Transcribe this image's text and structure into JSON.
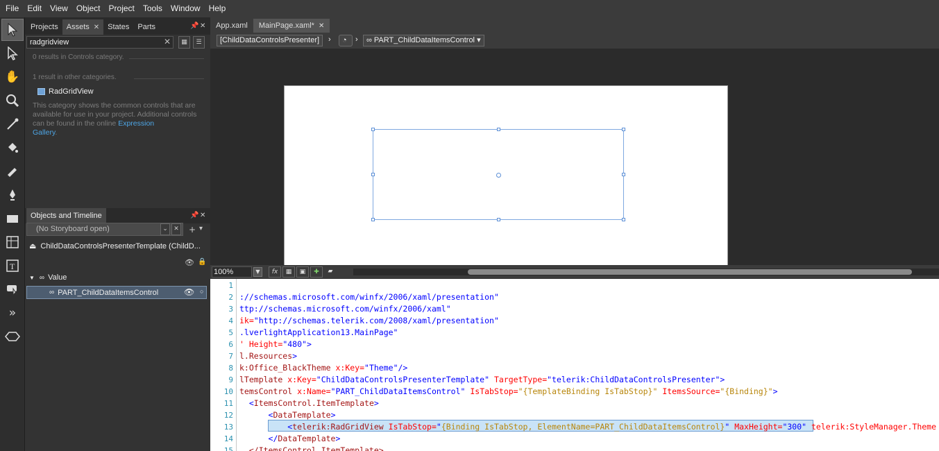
{
  "menu": [
    "File",
    "Edit",
    "View",
    "Object",
    "Project",
    "Tools",
    "Window",
    "Help"
  ],
  "left_panel": {
    "tabs": [
      {
        "label": "Projects",
        "active": false
      },
      {
        "label": "Assets",
        "active": true
      },
      {
        "label": "States",
        "active": false
      },
      {
        "label": "Parts",
        "active": false
      }
    ],
    "search_value": "radgridview",
    "controls_result": "0 results in Controls category.",
    "other_result": "1 result in other categories.",
    "asset_item": "RadGridView",
    "description": "This category shows the common controls that are available for use in your project. Additional controls can be found in the online",
    "link_line1": "Expression",
    "link_line2": "Gallery",
    "link_tail": "."
  },
  "objects_panel": {
    "title": "Objects and Timeline",
    "storyboard": "(No Storyboard open)",
    "tree_root": "ChildDataControlsPresenterTemplate (ChildD...",
    "tree_value": "Value",
    "tree_child": "PART_ChildDataItemsControl"
  },
  "document_tabs": [
    {
      "label": "App.xaml",
      "active": false
    },
    {
      "label": "MainPage.xaml*",
      "active": true
    }
  ],
  "breadcrumb": {
    "first": "[ChildDataControlsPresenter]",
    "last": "PART_ChildDataItemsControl"
  },
  "status": {
    "zoom": "100%"
  },
  "code": {
    "line_numbers": [
      "1",
      "2",
      "3",
      "4",
      "5",
      "6",
      "7",
      "8",
      "9",
      "10",
      "11",
      "12",
      "13",
      "14",
      "15"
    ],
    "l2a": "://schemas.microsoft.com/winfx/2006/xaml/presentation\"",
    "l3a": "ttp://schemas.microsoft.com/winfx/2006/xaml\"",
    "l4a": "ik=",
    "l4b": "\"http://schemas.telerik.com/2008/xaml/presentation\"",
    "l5a": ".lverlightApplication13.MainPage\"",
    "l6a": "' Height=",
    "l6b": "\"480\"",
    "l6c": ">",
    "l7a": "l.Resources",
    "l7b": ">",
    "l8a": "k:Office_BlackTheme",
    "l8b": " x:Key=",
    "l8c": "\"Theme\"",
    "l8d": "/>",
    "l9a": "lTemplate",
    "l9b": " x:Key=",
    "l9c": "\"ChildDataControlsPresenterTemplate\"",
    "l9d": " TargetType=",
    "l9e": "\"telerik:ChildDataControlsPresenter\"",
    "l9f": ">",
    "l10a": "temsControl",
    "l10b": " x:Name=",
    "l10c": "\"PART_ChildDataItemsControl\"",
    "l10d": " IsTabStop=",
    "l10e": "\"{TemplateBinding IsTabStop}\"",
    "l10f": " ItemsSource=",
    "l10g": "\"{Binding}\"",
    "l10h": ">",
    "l11a": "  <",
    "l11b": "ItemsControl.ItemTemplate",
    "l11c": ">",
    "l12a": "      <",
    "l12b": "DataTemplate",
    "l12c": ">",
    "l13a": "          <",
    "l13b": "telerik:RadGridView",
    "l13c": " IsTabStop=",
    "l13d": "\"",
    "l13e": "{Binding IsTabStop, ElementName=PART_ChildDataItemsControl}",
    "l13f": "\"",
    "l13g": " MaxHeight=",
    "l13h": "\"300\"",
    "l13i": " telerik:StyleManager.Theme",
    "l14a": "      </",
    "l14b": "DataTemplate",
    "l14c": ">",
    "l15a": "  </ItemsControl.ItemTemplate>"
  },
  "colors": {
    "selection_blue": "#7ea8e0",
    "link": "#4ea6e6",
    "xaml_tag": "#a31515",
    "xaml_attr": "#ff0000",
    "xaml_value": "#0000ff"
  }
}
